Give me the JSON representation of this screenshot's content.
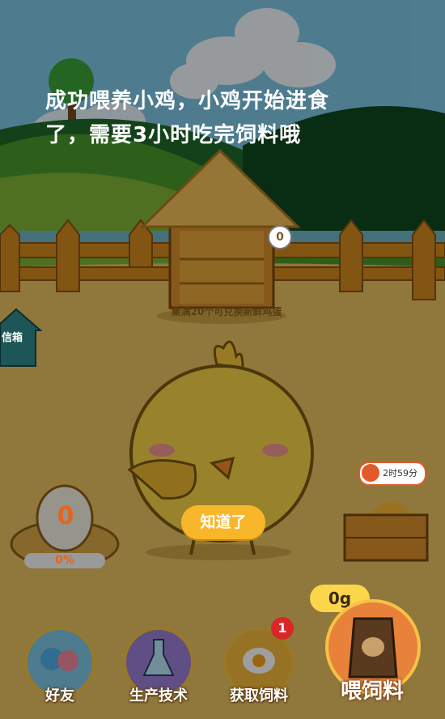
{
  "tip_text": "成功喂养小鸡，小鸡开始进食了，需要3小时吃完饲料哦",
  "coop": {
    "egg_capacity_counter": "0",
    "note": "集满20个可兑换新鲜鸡蛋"
  },
  "mailbox": {
    "label": "信箱"
  },
  "egg_nest": {
    "count": "0",
    "progress": {
      "fraction": 0.0,
      "label": "0%"
    }
  },
  "dialog": {
    "confirm_label": "知道了"
  },
  "feeder": {
    "timer_text": "2时59分"
  },
  "feed": {
    "weight": "0g",
    "button_label": "喂饲料"
  },
  "nav": {
    "friends": "好友",
    "production_tech": "生产技术",
    "get_feed": "获取饲料",
    "get_feed_badge": "1"
  },
  "colors": {
    "accent": "#f8b62a",
    "feed_button": "#e8823a",
    "badge": "#d9262a"
  }
}
